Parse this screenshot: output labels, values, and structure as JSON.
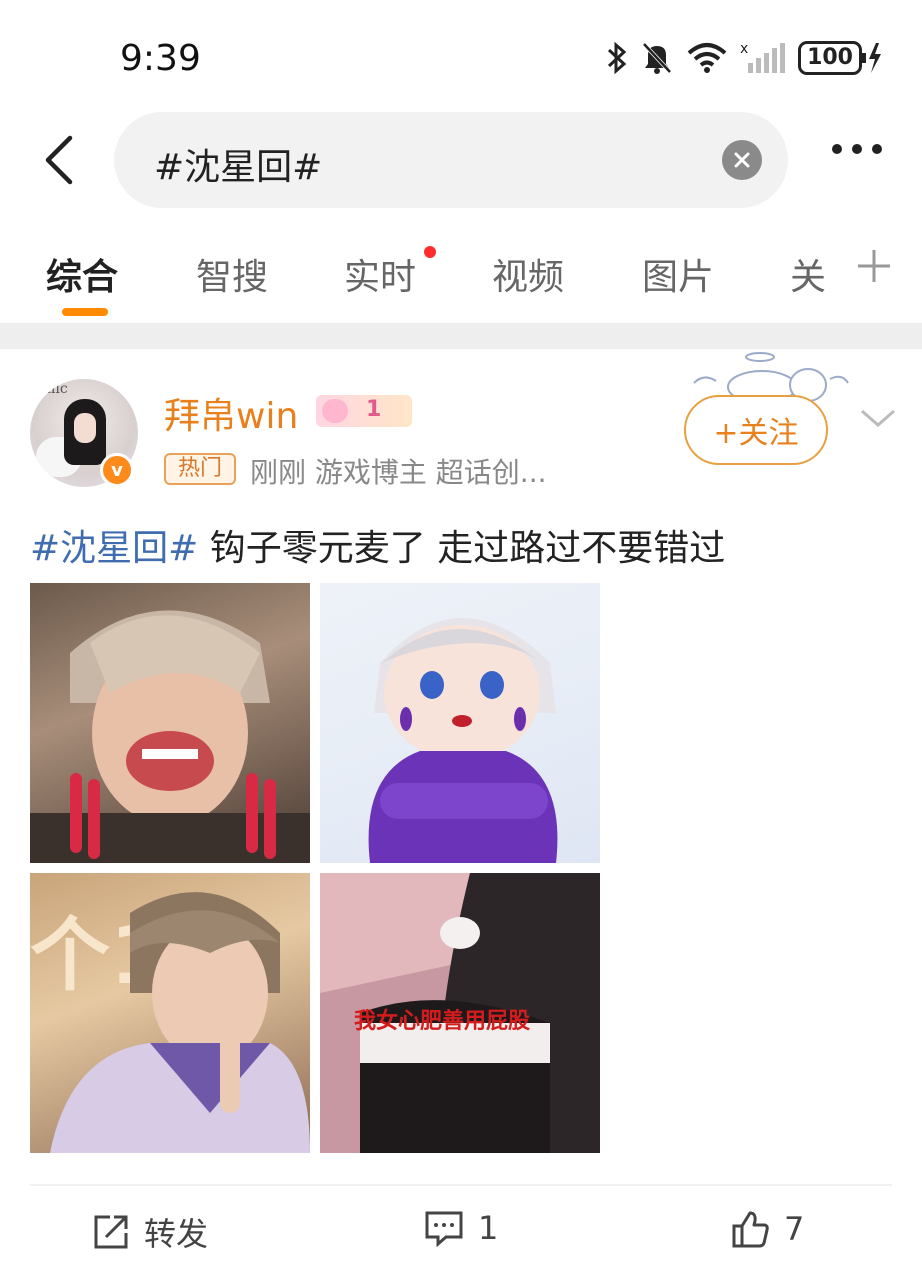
{
  "status": {
    "time": "9:39",
    "battery": "100"
  },
  "search": {
    "query": "#沈星回#"
  },
  "tabs": [
    {
      "label": "综合"
    },
    {
      "label": "智搜"
    },
    {
      "label": "实时"
    },
    {
      "label": "视频"
    },
    {
      "label": "图片"
    },
    {
      "label": "关"
    }
  ],
  "post": {
    "avatar_text": "Amic",
    "username": "拜帛win",
    "level_badge": "1",
    "hot_badge": "热门",
    "meta": "刚刚  游戏博主 超话创...",
    "follow_label": "+关注",
    "content_tag": "#沈星回#",
    "content_text": " 钩子零元麦了 走过路过不要错过",
    "image4_caption": "我女心肥善用屁股",
    "actions": {
      "repost_label": "转发",
      "comment_count": "1",
      "like_count": "7"
    }
  },
  "colors": {
    "accent": "#ff8a00",
    "username": "#e8801e",
    "tag": "#3f6db0",
    "notify_dot": "#ff2d2d"
  }
}
